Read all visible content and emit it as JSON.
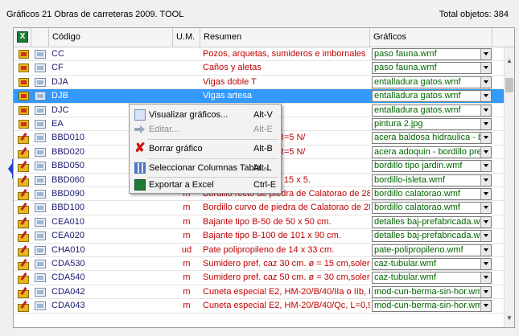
{
  "header": {
    "title": "Gráficos  21 Obras de carreteras 2009. TOOL",
    "total": "Total objetos:  384"
  },
  "columns": {
    "codigo": "Código",
    "um": "U.M.",
    "resumen": "Resumen",
    "graficos": "Gráficos"
  },
  "rows": [
    {
      "codigo": "CC",
      "um": "",
      "resumen": "Pozos, arquetas, sumideros e imbornales",
      "grafico": "paso fauna.wmf",
      "icon": "folder-icon"
    },
    {
      "codigo": "CF",
      "um": "",
      "resumen": "Caños y aletas",
      "grafico": "paso fauna.wmf",
      "icon": "folder-icon"
    },
    {
      "codigo": "DJA",
      "um": "",
      "resumen": "Vigas doble T",
      "grafico": "entalladura gatos.wmf",
      "icon": "folder-icon"
    },
    {
      "codigo": "DJB",
      "um": "",
      "resumen": "Vigas artesa",
      "grafico": "entalladura gatos.wmf",
      "icon": "folder-icon"
    },
    {
      "codigo": "DJC",
      "um": "",
      "resumen": "",
      "grafico": "entalladura gatos.wmf",
      "icon": "folder-icon"
    },
    {
      "codigo": "EA",
      "um": "",
      "resumen": "",
      "grafico": "pintura 2.jpg",
      "icon": "folder-icon"
    },
    {
      "codigo": "BBD010",
      "um": "",
      "resumen": "n 25 x 12 x 15 cm, R=5 N/",
      "grafico": "acera baldosa hidraulica - bord",
      "icon": "pen-icon"
    },
    {
      "codigo": "BBD020",
      "um": "",
      "resumen": "n 25 x 12 x 15 cm. R=5 N/",
      "grafico": "acera adoquin - bordillo prefal",
      "icon": "pen-icon"
    },
    {
      "codigo": "BBD050",
      "um": "",
      "resumen": " cm. tipo jardín.",
      "grafico": "bordillo tipo jardin.wmf",
      "icon": "pen-icon"
    },
    {
      "codigo": "BBD060",
      "um": "",
      "resumen": "do o isleta 50 x 25 x 15 x 5.",
      "grafico": "bordillo-isleta.wmf",
      "icon": "pen-icon"
    },
    {
      "codigo": "BBD090",
      "um": "m",
      "resumen": "Bordillo recto de piedra de Calatorao de 28 X 20. Sc",
      "grafico": "bordillo calatorao.wmf",
      "icon": "pen-icon"
    },
    {
      "codigo": "BBD100",
      "um": "m",
      "resumen": "Bordillo curvo de piedra de Calatorao de 28 X 20. Sc",
      "grafico": "bordillo calatorao.wmf",
      "icon": "pen-icon"
    },
    {
      "codigo": "CEA010",
      "um": "m",
      "resumen": "Bajante tipo B-50 de 50 x 50 cm.",
      "grafico": "detalles baj-prefabricada.wmf",
      "icon": "pen-icon"
    },
    {
      "codigo": "CEA020",
      "um": "m",
      "resumen": "Bajante tipo B-100 de 101 x 90 cm.",
      "grafico": "detalles baj-prefabricada.wmf",
      "icon": "pen-icon"
    },
    {
      "codigo": "CHA010",
      "um": "ud",
      "resumen": "Pate polipropileno de 14 x 33 cm.",
      "grafico": "pate-polipropileno.wmf",
      "icon": "pen-icon"
    },
    {
      "codigo": "CDA530",
      "um": "m",
      "resumen": "Sumidero pref. caz 30 cm. ø = 15 cm,solera HM-20.",
      "grafico": "caz-tubular.wmf",
      "icon": "pen-icon"
    },
    {
      "codigo": "CDA540",
      "um": "m",
      "resumen": "Sumidero pref. caz 50 cm. ø = 30 cm,solera HM-20.",
      "grafico": "caz-tubular.wmf",
      "icon": "pen-icon"
    },
    {
      "codigo": "CDA042",
      "um": "m",
      "resumen": "Cuneta especial E2, HM-20/B/40/IIa o IIb, L=0,90 T=",
      "grafico": "mod-cun-berma-sin-hor.wmf",
      "icon": "pen-icon"
    },
    {
      "codigo": "CDA043",
      "um": "m",
      "resumen": "Cuneta especial E2, HM-20/B/40/Qc, L=0,90 T=6/1,",
      "grafico": "mod-cun-berma-sin-hor.wmf",
      "icon": "pen-icon"
    }
  ],
  "context_menu": {
    "items": [
      {
        "label": "Visualizar gráficos...",
        "shortcut": "Alt-V",
        "icon": "view-graphics-icon",
        "enabled": true
      },
      {
        "label": "Editar...",
        "shortcut": "Alt-E",
        "icon": "edit-arrow-icon",
        "enabled": false
      },
      {
        "label": "Borrar gráfico",
        "shortcut": "Alt-B",
        "icon": "delete-icon",
        "enabled": true
      },
      {
        "label": "Seleccionar Columnas Tabla...",
        "shortcut": "Alt-L",
        "icon": "columns-icon",
        "enabled": true
      },
      {
        "label": "Exportar a Excel",
        "shortcut": "Ctrl-E",
        "icon": "excel-icon",
        "enabled": true
      }
    ]
  },
  "colors": {
    "selection": "#3399ff",
    "resumen_text": "#c00000",
    "grafico_text": "#006400"
  }
}
